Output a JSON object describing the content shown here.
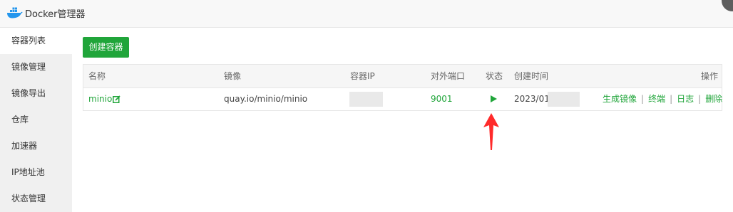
{
  "window": {
    "title": "Docker管理器"
  },
  "sidebar": {
    "items": [
      {
        "label": "容器列表",
        "active": true
      },
      {
        "label": "镜像管理"
      },
      {
        "label": "镜像导出"
      },
      {
        "label": "仓库"
      },
      {
        "label": "加速器"
      },
      {
        "label": "IP地址池"
      },
      {
        "label": "状态管理"
      }
    ]
  },
  "toolbar": {
    "create_label": "创建容器"
  },
  "table": {
    "headers": {
      "name": "名称",
      "image": "镜像",
      "ip": "容器IP",
      "port": "对外端口",
      "status": "状态",
      "created": "创建时间",
      "ops": "操作"
    },
    "rows": [
      {
        "name": "minio",
        "image": "quay.io/minio/minio",
        "port": "9001",
        "created": "2023/01/",
        "status_icon": "play-icon",
        "ops": [
          "生成镜像",
          "终端",
          "日志",
          "删除"
        ]
      }
    ]
  },
  "colors": {
    "accent": "#20a53a",
    "annotation_arrow": "#ff2a2a"
  }
}
